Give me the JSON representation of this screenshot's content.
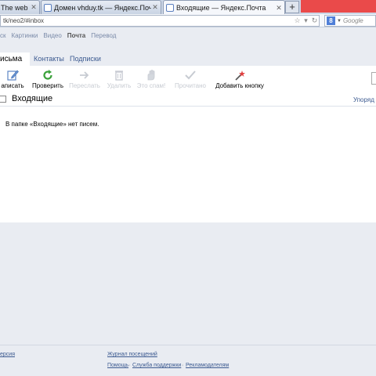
{
  "browser": {
    "tabs": [
      {
        "label": "The web p..."
      },
      {
        "label": "Домен vhduy.tk — Яндекс.Почта дл..."
      },
      {
        "label": "Входящие — Яндекс.Почта"
      }
    ],
    "new_tab": "+",
    "url": "tk/neo2/#inbox",
    "search_engine_letter": "8",
    "search_placeholder": "Google"
  },
  "services": [
    "ск",
    "Картинки",
    "Видео",
    "Почта",
    "Перевод"
  ],
  "mail_tabs": {
    "letters": "исьма",
    "contacts": "Контакты",
    "subscriptions": "Подписки"
  },
  "toolbar": {
    "compose": "аписать",
    "check": "Проверить",
    "forward": "Переслать",
    "delete": "Удалить",
    "spam": "Это спам!",
    "read": "Прочитано",
    "add_button": "Добавить кнопку"
  },
  "folder": {
    "title": "Входящие",
    "order_link": "Упоряд"
  },
  "empty_message": "В папке «Входящие» нет писем.",
  "footer": {
    "version": "ерсия",
    "history": "Журнал посещений",
    "help": "Помощь",
    "support": "Служба поддержки",
    "ads": "Рекламодателям",
    "sep": "·"
  },
  "colors": {
    "page_bg": "#e9ecf2",
    "link": "#3c5a90",
    "check_green": "#3aa13a",
    "close_red": "#ea4a4a"
  }
}
